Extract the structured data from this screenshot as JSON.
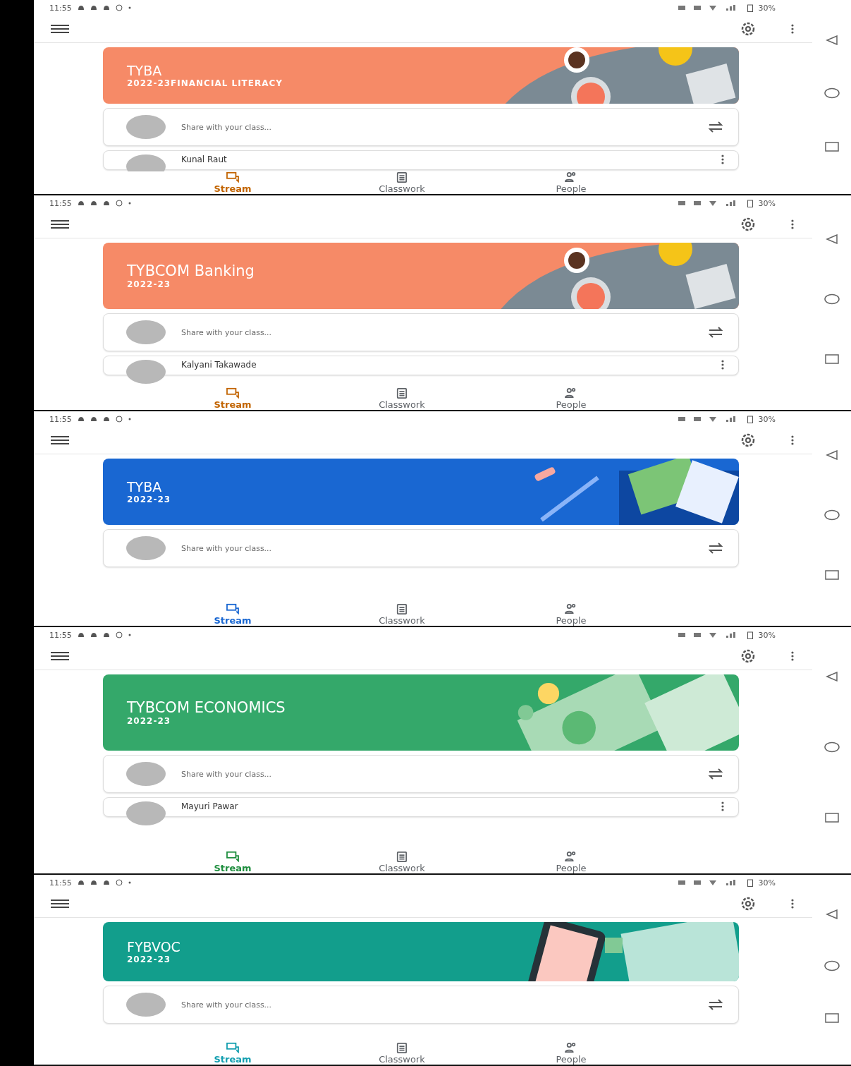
{
  "screens": [
    {
      "status_bar": {
        "time": "11:55",
        "battery": "30%"
      },
      "class": {
        "title": "TYBA",
        "subtitle": "2022-23FINANCIAL LITERACY",
        "color": "#f68a67",
        "kind": "desk"
      },
      "share_prompt": "Share with your class...",
      "posts": [
        {
          "author": "Kunal Raut"
        }
      ],
      "nav": [
        {
          "label": "Stream",
          "selected": true,
          "color": "#c26401"
        },
        {
          "label": "Classwork",
          "selected": false,
          "color": "#5f6368"
        },
        {
          "label": "People",
          "selected": false,
          "color": "#5f6368"
        }
      ]
    },
    {
      "status_bar": {
        "time": "11:55",
        "battery": "30%"
      },
      "class": {
        "title": "TYBCOM Banking",
        "subtitle": "2022-23",
        "color": "#f68a67",
        "kind": "desk"
      },
      "share_prompt": "Share with your class...",
      "posts": [
        {
          "author": "Kalyani Takawade"
        }
      ],
      "nav": [
        {
          "label": "Stream",
          "selected": true,
          "color": "#c26401"
        },
        {
          "label": "Classwork",
          "selected": false,
          "color": "#5f6368"
        },
        {
          "label": "People",
          "selected": false,
          "color": "#5f6368"
        }
      ]
    },
    {
      "status_bar": {
        "time": "11:55",
        "battery": "30%"
      },
      "class": {
        "title": "TYBA",
        "subtitle": "2022-23",
        "color": "#1967d2",
        "kind": "school"
      },
      "share_prompt": "Share with your class...",
      "nav": [
        {
          "label": "Stream",
          "selected": true,
          "color": "#1967d2"
        },
        {
          "label": "Classwork",
          "selected": false,
          "color": "#5f6368"
        },
        {
          "label": "People",
          "selected": false,
          "color": "#5f6368"
        }
      ]
    },
    {
      "status_bar": {
        "time": "11:55",
        "battery": "30%"
      },
      "class": {
        "title": "TYBCOM ECONOMICS",
        "subtitle": "2022-23",
        "color": "#34a86a",
        "kind": "money"
      },
      "share_prompt": "Share with your class...",
      "posts": [
        {
          "author": "Mayuri Pawar"
        }
      ],
      "nav": [
        {
          "label": "Stream",
          "selected": true,
          "color": "#1e8e3e"
        },
        {
          "label": "Classwork",
          "selected": false,
          "color": "#5f6368"
        },
        {
          "label": "People",
          "selected": false,
          "color": "#5f6368"
        }
      ]
    },
    {
      "status_bar": {
        "time": "11:55",
        "battery": "30%"
      },
      "class": {
        "title": "FYBVOC",
        "subtitle": "2022-23",
        "color": "#129e8c",
        "kind": "phone"
      },
      "share_prompt": "Share with your class...",
      "nav": [
        {
          "label": "Stream",
          "selected": true,
          "color": "#129eaf"
        },
        {
          "label": "Classwork",
          "selected": false,
          "color": "#5f6368"
        },
        {
          "label": "People",
          "selected": false,
          "color": "#5f6368"
        }
      ]
    }
  ]
}
